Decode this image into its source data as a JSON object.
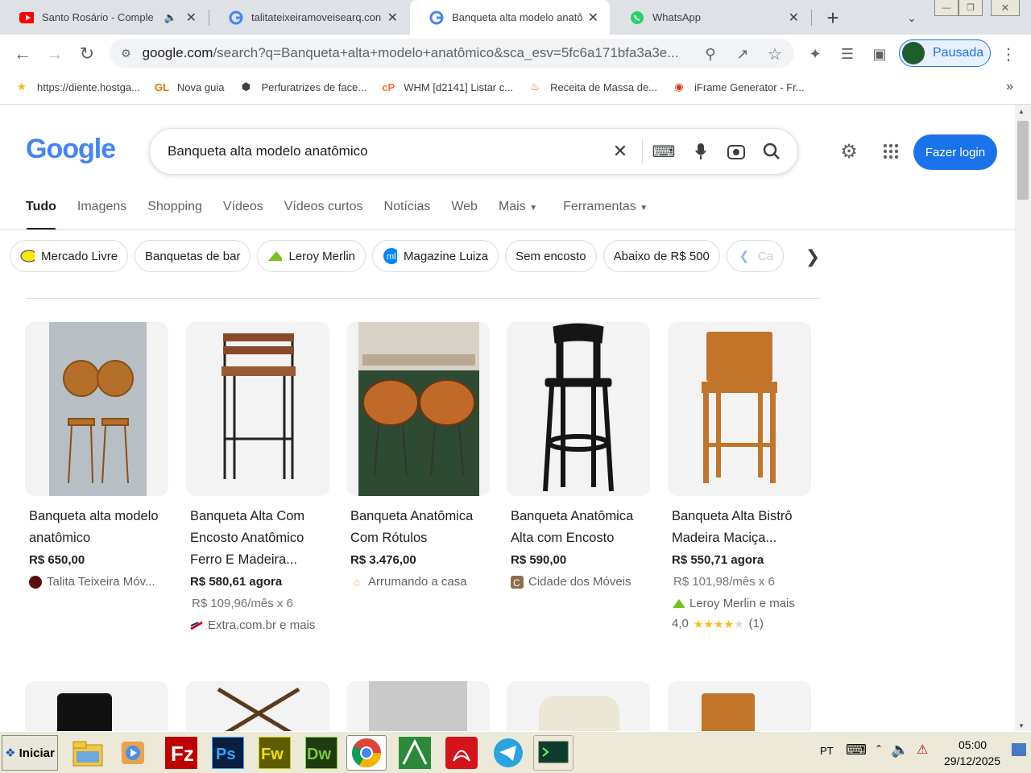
{
  "browser": {
    "tabs": [
      {
        "title": "Santo Rosário - Comple",
        "icon": "youtube-icon",
        "muted": true
      },
      {
        "title": "talitateixeiramoveisearq.con",
        "icon": "google-icon"
      },
      {
        "title": "Banqueta alta modelo anatô",
        "icon": "google-icon",
        "active": true
      },
      {
        "title": "WhatsApp",
        "icon": "whatsapp-icon"
      }
    ],
    "url_host": "google.com",
    "url_path": "/search?q=Banqueta+alta+modelo+anatômico&sca_esv=5fc6a171bfa3a3e...",
    "profile_label": "Pausada",
    "bookmarks": [
      {
        "label": "https://diente.hostga...",
        "icon": "bookmark-site-icon"
      },
      {
        "label": "Nova guia",
        "icon": "gl-icon"
      },
      {
        "label": "Perfuratrizes de face...",
        "icon": "cube-icon"
      },
      {
        "label": "WHM [d2141] Listar c...",
        "icon": "cpanel-icon"
      },
      {
        "label": "Receita de Massa de...",
        "icon": "recipe-icon"
      },
      {
        "label": "iFrame Generator - Fr...",
        "icon": "iframe-icon"
      }
    ]
  },
  "google": {
    "logo_text": "Google",
    "query": "Banqueta alta modelo anatômico",
    "login_label": "Fazer login",
    "tabs": [
      "Tudo",
      "Imagens",
      "Shopping",
      "Vídeos",
      "Vídeos curtos",
      "Notícias",
      "Web",
      "Mais",
      "Ferramentas"
    ],
    "chips": [
      {
        "label": "Mercado Livre",
        "icon": "mercadolivre-icon"
      },
      {
        "label": "Banquetas de bar",
        "icon": ""
      },
      {
        "label": "Leroy Merlin",
        "icon": "leroy-icon"
      },
      {
        "label": "Magazine Luiza",
        "icon": "magalu-icon"
      },
      {
        "label": "Sem encosto",
        "icon": ""
      },
      {
        "label": "Abaixo de R$ 500",
        "icon": ""
      },
      {
        "label": "Ca",
        "icon": "casas-icon"
      }
    ],
    "products": [
      {
        "title": "Banqueta alta modelo anatômico",
        "price": "R$ 650,00",
        "installment": "",
        "source": "Talita Teixeira Móv...",
        "rating": "",
        "reviews": ""
      },
      {
        "title": "Banqueta Alta Com Encosto Anatômico Ferro E Madeira...",
        "price": "R$ 580,61 agora",
        "installment": "R$ 109,96/mês x 6",
        "source": "Extra.com.br e mais",
        "rating": "",
        "reviews": ""
      },
      {
        "title": "Banqueta Anatômica Com Rótulos",
        "price": "R$ 3.476,00",
        "installment": "",
        "source": "Arrumando a casa",
        "rating": "",
        "reviews": ""
      },
      {
        "title": "Banqueta Anatômica Alta com Encosto",
        "price": "R$ 590,00",
        "installment": "",
        "source": "Cidade dos Móveis",
        "rating": "",
        "reviews": ""
      },
      {
        "title": "Banqueta Alta Bistrô Madeira Maciça...",
        "price": "R$ 550,71 agora",
        "installment": "R$ 101,98/mês x 6",
        "source": "Leroy Merlin e mais",
        "rating": "4,0",
        "reviews": "(1)"
      }
    ]
  },
  "taskbar": {
    "start_label": "Iniciar",
    "lang": "PT",
    "time": "05:00",
    "date": "29/12/2025"
  },
  "colors": {
    "login_bg": "#1a73e8",
    "tab_bg": "#dee1e6"
  }
}
